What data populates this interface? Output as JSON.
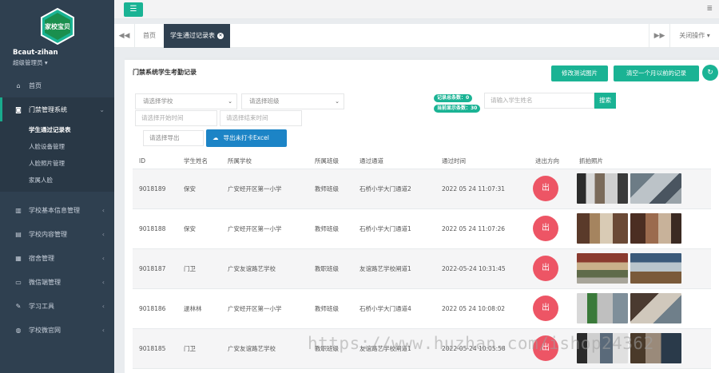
{
  "sidebar": {
    "logo_text": "家校宝贝",
    "username": "Bcaut-zihan",
    "role": "超级管理员",
    "items": [
      {
        "label": "首页",
        "icon": "home-icon"
      },
      {
        "label": "门禁管理系统",
        "icon": "camera-icon"
      },
      {
        "label": "学校基本信息管理",
        "icon": "building-icon"
      },
      {
        "label": "学校内容管理",
        "icon": "folder-icon"
      },
      {
        "label": "宿舍管理",
        "icon": "grid-icon"
      },
      {
        "label": "微信端管理",
        "icon": "desktop-icon"
      },
      {
        "label": "学习工具",
        "icon": "tools-icon"
      },
      {
        "label": "学校微官网",
        "icon": "globe-icon"
      }
    ],
    "submenu": [
      "学生通过记录表",
      "人脸设备管理",
      "人脸照片管理",
      "家属人脸"
    ]
  },
  "tabs": {
    "home": "首页",
    "current": "学生通过记录表",
    "close_ops": "关闭操作"
  },
  "panel": {
    "title": "门禁系统学生考勤记录",
    "btn_modify": "修改测试图片",
    "btn_clear": "清空一个月以前的记录",
    "select_school": "请选择学校",
    "select_class": "请选择班级",
    "start_time": "请选择开始时间",
    "end_time": "请选择结束时间",
    "select_export": "请选择导出",
    "export_btn": "导出未打卡Excel",
    "total_badge": "记录总条数：0",
    "shown_badge": "当前显示条数：30",
    "search_placeholder": "请输入学生姓名",
    "search_btn": "搜索"
  },
  "table": {
    "headers": [
      "ID",
      "学生姓名",
      "所属学校",
      "所属班级",
      "通过通道",
      "通过时间",
      "进出方向",
      "抓拍照片"
    ],
    "rows": [
      {
        "id": "9018189",
        "name": "保安",
        "school": "广安经开区第一小学",
        "class": "教师班级",
        "channel": "石桥小学大门通道2",
        "time": "2022 05 24 11:07:31",
        "dir": "出"
      },
      {
        "id": "9018188",
        "name": "保安",
        "school": "广安经开区第一小学",
        "class": "教师班级",
        "channel": "石桥小学大门通道1",
        "time": "2022 05 24 11:07:26",
        "dir": "出"
      },
      {
        "id": "9018187",
        "name": "门卫",
        "school": "广安友谊路艺学校",
        "class": "教职班级",
        "channel": "友谊路艺学校闸道1",
        "time": "2022-05-24 10:31:45",
        "dir": "出"
      },
      {
        "id": "9018186",
        "name": "逯林林",
        "school": "广安经开区第一小学",
        "class": "教师班级",
        "channel": "石桥小学大门通道4",
        "time": "2022 05 24 10:08:02",
        "dir": "出"
      },
      {
        "id": "9018185",
        "name": "门卫",
        "school": "广安友谊路艺学校",
        "class": "教职班级",
        "channel": "友谊路艺学校闸道1",
        "time": "2022-05-24 10:05:58",
        "dir": "出"
      }
    ]
  },
  "watermark": "https://www.huzhan.com/ishop24362",
  "colors": {
    "accent": "#1ab394",
    "sidebar": "#2f4050",
    "danger": "#ed5565",
    "primary": "#1c84c6"
  }
}
